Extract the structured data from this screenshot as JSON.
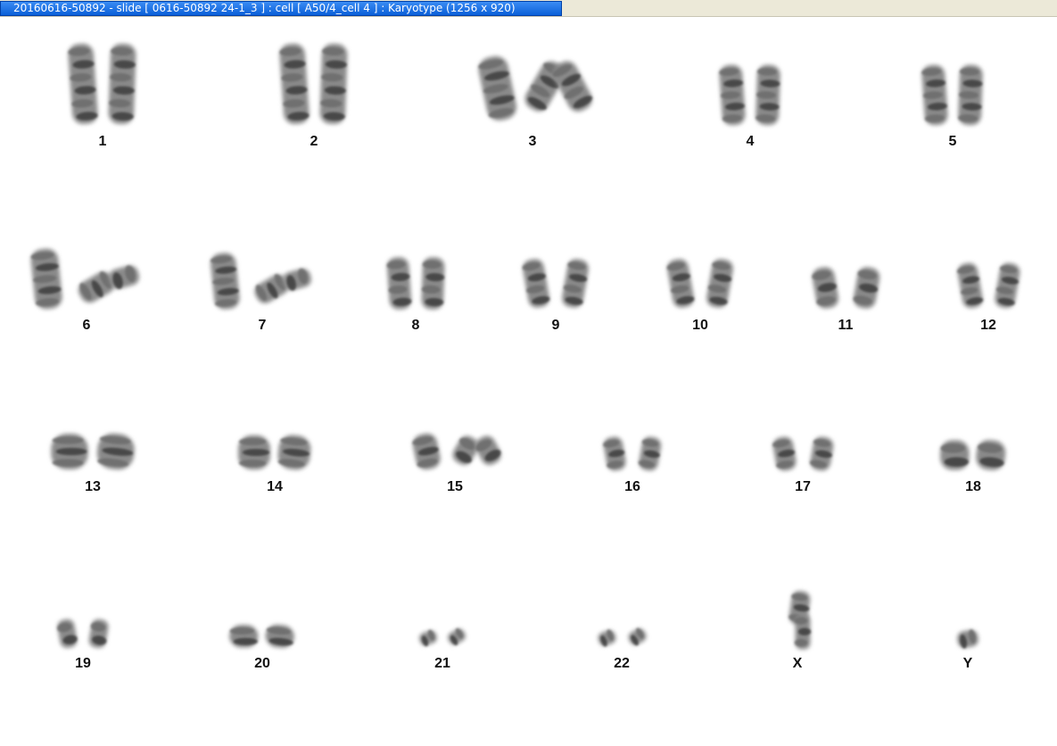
{
  "window": {
    "title": "20160616-50892 - slide [ 0616-50892 24-1_3 ] : cell [ A50/4_cell 4 ] : Karyotype  (1256 x 920)"
  },
  "colors": {
    "title_bar": "#0a5fd8",
    "chromosome": "#555555",
    "background": "#ffffff"
  },
  "karyotype": {
    "labels": [
      "1",
      "2",
      "3",
      "4",
      "5",
      "6",
      "7",
      "8",
      "9",
      "10",
      "11",
      "12",
      "13",
      "14",
      "15",
      "16",
      "17",
      "18",
      "19",
      "20",
      "21",
      "22",
      "X",
      "Y"
    ]
  }
}
